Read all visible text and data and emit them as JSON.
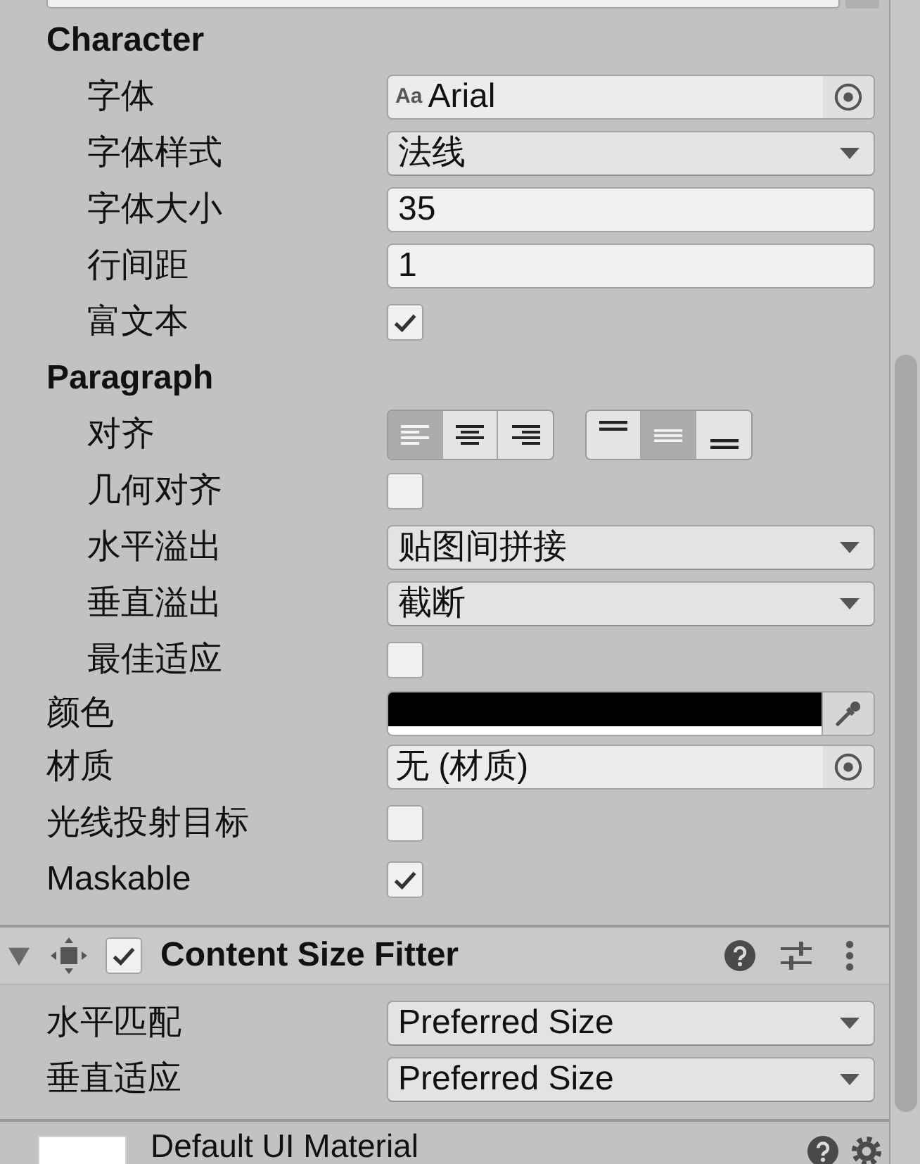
{
  "sections": [
    {
      "title": "Character",
      "properties": [
        {
          "label": "字体",
          "kind": "object",
          "icon_text": "Aa",
          "value": "Arial"
        },
        {
          "label": "字体样式",
          "kind": "dropdown",
          "value": "法线"
        },
        {
          "label": "字体大小",
          "kind": "text",
          "value": "35"
        },
        {
          "label": "行间距",
          "kind": "text",
          "value": "1"
        },
        {
          "label": "富文本",
          "kind": "checkbox",
          "checked": true
        }
      ]
    },
    {
      "title": "Paragraph",
      "properties": [
        {
          "label": "对齐",
          "kind": "alignment",
          "horizontal": [
            {
              "kind": "left",
              "selected": true
            },
            {
              "kind": "center",
              "selected": false
            },
            {
              "kind": "right",
              "selected": false
            }
          ],
          "vertical": [
            {
              "kind": "top",
              "selected": false
            },
            {
              "kind": "middle",
              "selected": true
            },
            {
              "kind": "bottom",
              "selected": false
            }
          ]
        },
        {
          "label": "几何对齐",
          "kind": "checkbox",
          "checked": false
        },
        {
          "label": "水平溢出",
          "kind": "dropdown",
          "value": "贴图间拼接"
        },
        {
          "label": "垂直溢出",
          "kind": "dropdown",
          "value": "截断"
        },
        {
          "label": "最佳适应",
          "kind": "checkbox",
          "checked": false
        }
      ]
    }
  ],
  "properties": [
    {
      "label": "颜色",
      "kind": "color",
      "color": "#000000",
      "level": 1
    },
    {
      "label": "材质",
      "kind": "object",
      "value": "无 (材质)"
    },
    {
      "label": "光线投射目标",
      "kind": "checkbox",
      "checked": false
    },
    {
      "label": "Maskable",
      "kind": "checkbox",
      "checked": true
    }
  ],
  "components": [
    {
      "title": "Content Size Fitter",
      "expanded": true,
      "enabled": true,
      "properties": [
        {
          "label": "水平匹配",
          "kind": "dropdown",
          "value": "Preferred Size"
        },
        {
          "label": "垂直适应",
          "kind": "dropdown",
          "value": "Preferred Size"
        }
      ]
    }
  ],
  "material": {
    "name": "Default UI Material"
  }
}
